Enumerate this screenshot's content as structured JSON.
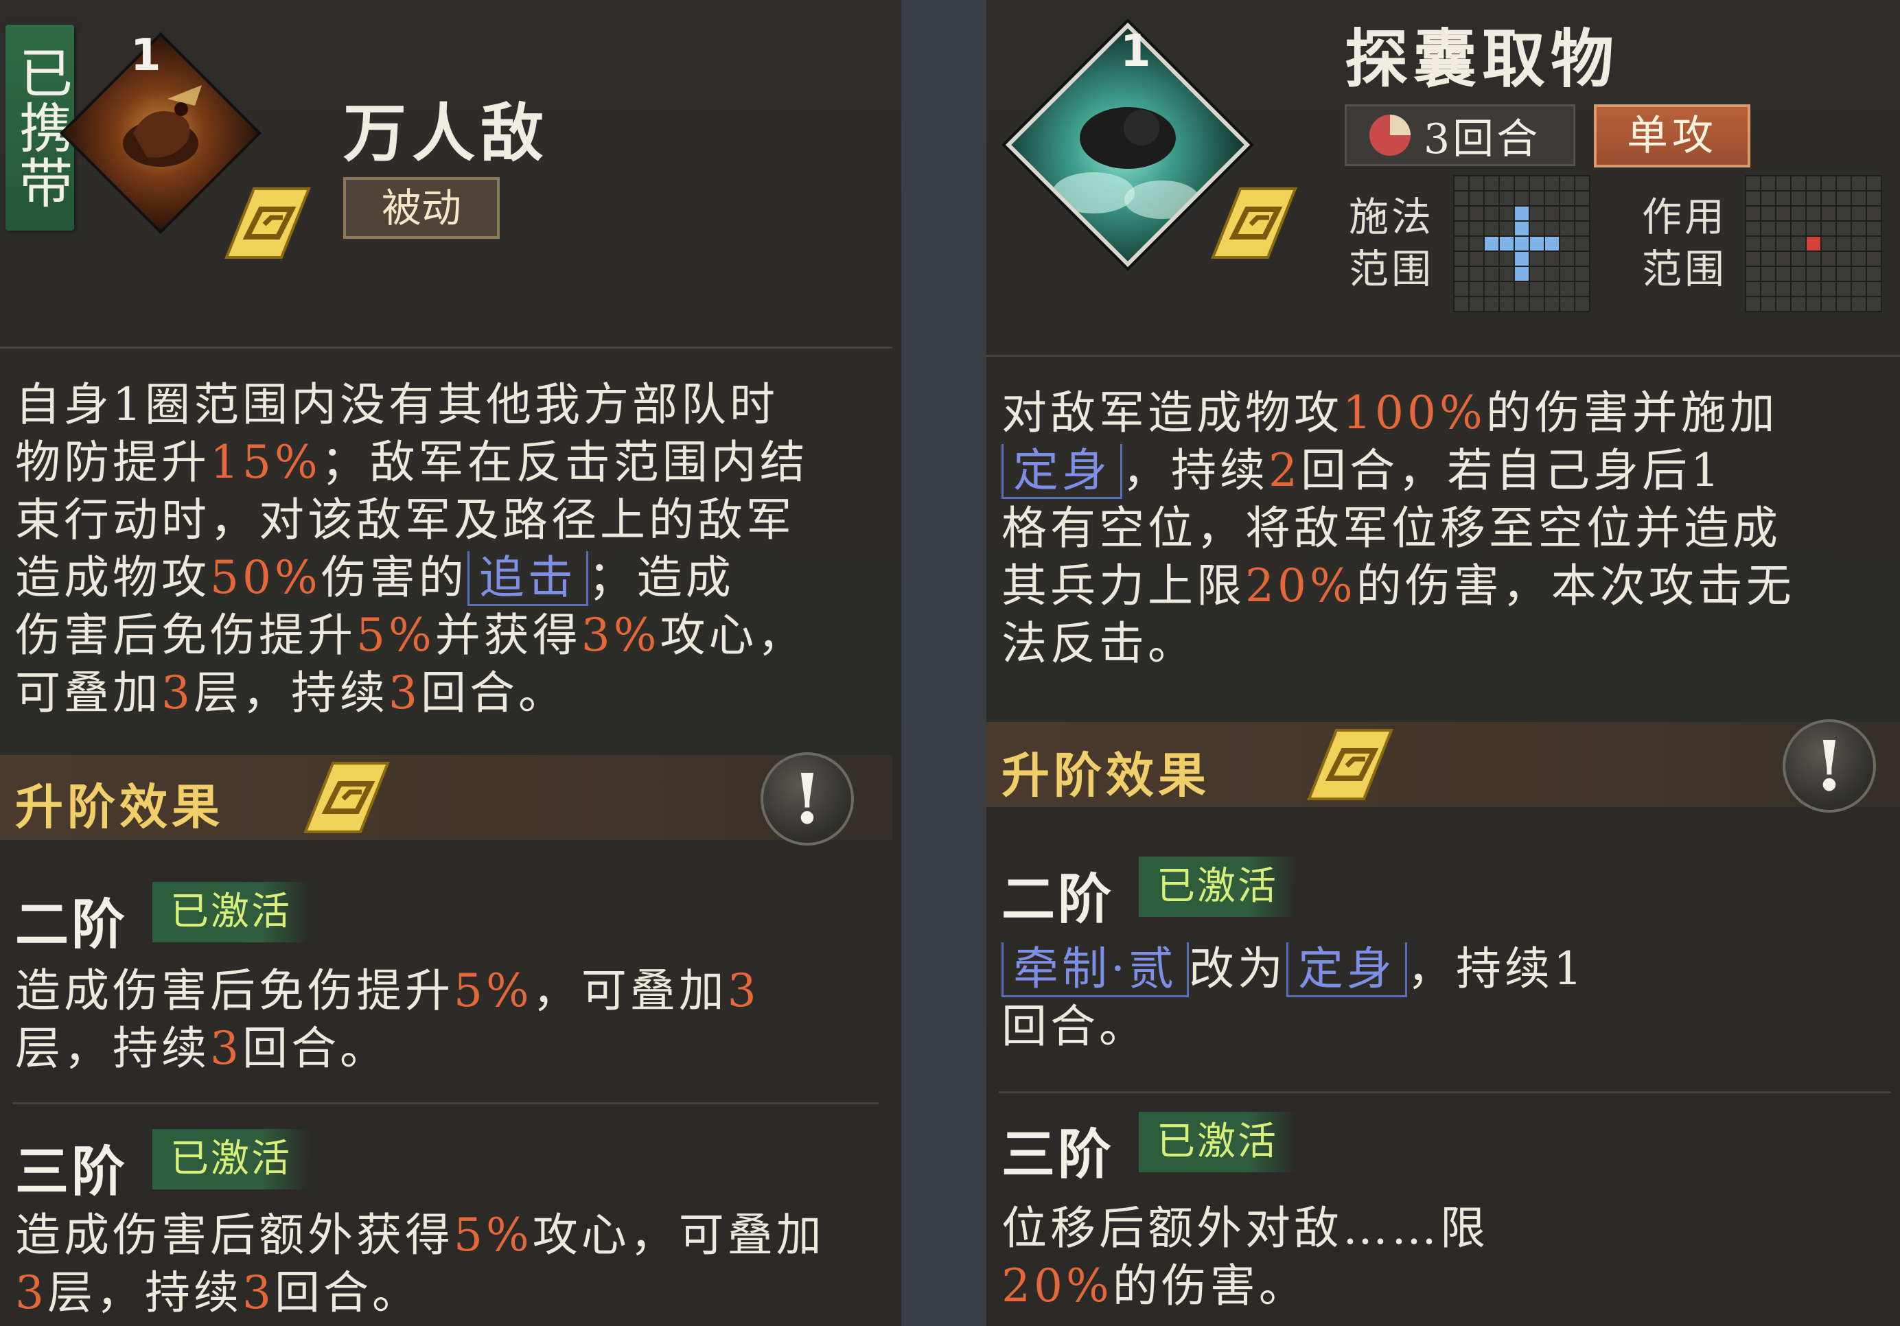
{
  "left": {
    "carried_label": "已携带",
    "level": "1",
    "title": "万人敌",
    "type_tag": "被动",
    "desc_lines": [
      [
        {
          "t": "自身1圈范围内没有其他我方部队时"
        }
      ],
      [
        {
          "t": "物防提升"
        },
        {
          "t": "15%",
          "h": 1
        },
        {
          "t": "；敌军在反击范围内结"
        }
      ],
      [
        {
          "t": "束行动时，对该敌军及路径上的敌军"
        }
      ],
      [
        {
          "t": "造成物攻"
        },
        {
          "t": "50%",
          "h": 1
        },
        {
          "t": "伤害的"
        },
        {
          "t": "追击",
          "k": 1
        },
        {
          "t": "；造成"
        }
      ],
      [
        {
          "t": "伤害后免伤提升"
        },
        {
          "t": "5%",
          "h": 1
        },
        {
          "t": "并获得"
        },
        {
          "t": "3%",
          "h": 1
        },
        {
          "t": "攻心，"
        }
      ],
      [
        {
          "t": "可叠加"
        },
        {
          "t": "3",
          "h": 1
        },
        {
          "t": "层，持续"
        },
        {
          "t": "3",
          "h": 1
        },
        {
          "t": "回合。"
        }
      ]
    ],
    "upgrade_label": "升阶效果",
    "alert_icon": "!",
    "tiers": [
      {
        "name": "二阶",
        "status": "已激活",
        "lines": [
          [
            {
              "t": "造成伤害后免伤提升"
            },
            {
              "t": "5%",
              "h": 1
            },
            {
              "t": "，可叠加"
            },
            {
              "t": "3",
              "h": 1
            }
          ],
          [
            {
              "t": "层，持续"
            },
            {
              "t": "3",
              "h": 1
            },
            {
              "t": "回合。"
            }
          ]
        ]
      },
      {
        "name": "三阶",
        "status": "已激活",
        "lines": [
          [
            {
              "t": "造成伤害后额外获得"
            },
            {
              "t": "5%",
              "h": 1
            },
            {
              "t": "攻心，可叠加"
            }
          ],
          [
            {
              "t": "3",
              "h": 1
            },
            {
              "t": "层，持续"
            },
            {
              "t": "3",
              "h": 1
            },
            {
              "t": "回合。"
            }
          ]
        ]
      }
    ]
  },
  "right": {
    "level": "1",
    "title": "探囊取物",
    "cooldown": "3回合",
    "attack_type": "单攻",
    "cast_range_label": "施法\n范围",
    "effect_range_label": "作用\n范围",
    "desc_lines": [
      [
        {
          "t": "对敌军造成物攻"
        },
        {
          "t": "100%",
          "h": 1
        },
        {
          "t": "的伤害并施加"
        }
      ],
      [
        {
          "t": "定身",
          "k": 1
        },
        {
          "t": "，持续"
        },
        {
          "t": "2",
          "h": 1
        },
        {
          "t": "回合，若自己身后1"
        }
      ],
      [
        {
          "t": "格有空位，将敌军位移至空位并造成"
        }
      ],
      [
        {
          "t": "其兵力上限"
        },
        {
          "t": "20%",
          "h": 1
        },
        {
          "t": "的伤害，本次攻击无"
        }
      ],
      [
        {
          "t": "法反击。"
        }
      ]
    ],
    "upgrade_label": "升阶效果",
    "alert_icon": "!",
    "tiers": [
      {
        "name": "二阶",
        "status": "已激活",
        "lines": [
          [
            {
              "t": "牵制·贰",
              "k": 1
            },
            {
              "t": "改为"
            },
            {
              "t": "定身",
              "k": 1
            },
            {
              "t": "，持续1"
            }
          ],
          [
            {
              "t": "回合。"
            }
          ]
        ]
      },
      {
        "name": "三阶",
        "status": "已激活",
        "lines": [
          [
            {
              "t": "位移后额外对敌"
            },
            {
              "t": "……"
            },
            {
              "t": "限"
            }
          ],
          [
            {
              "t": "20%",
              "h": 1
            },
            {
              "t": "的伤害。"
            }
          ]
        ]
      }
    ]
  },
  "colors": {
    "highlight": "#e5673a",
    "keyword": "#7d8fe6",
    "badge": "#d9ef7c",
    "upgrade": "#f0cf6a"
  },
  "icons": [
    "rune-icon",
    "cooldown-pie-icon",
    "exclamation-icon",
    "portrait-icon"
  ]
}
